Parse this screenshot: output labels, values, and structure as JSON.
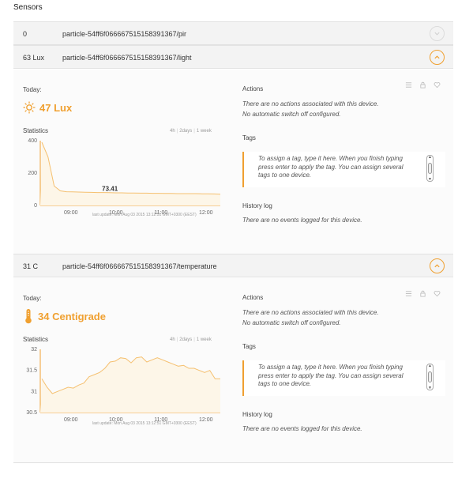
{
  "page_title": "Sensors",
  "colors": {
    "accent": "#f0a030",
    "fill": "#fdf6e8",
    "row_bg": "#f3f3f3"
  },
  "sensors": [
    {
      "value": "0",
      "id": "particle-54ff6f066667515158391367/pir",
      "expanded": false
    },
    {
      "value": "63 Lux",
      "id": "particle-54ff6f066667515158391367/light",
      "expanded": true,
      "icon": "sun-icon",
      "today_label": "Today:",
      "reading": "47 Lux",
      "stats_label": "Statistics",
      "ranges": [
        "4h",
        "2days",
        "1 week"
      ],
      "updated": "last update: Mon Aug 03 2015 13:12:51 GMT+0300 (EEST)",
      "actions_label": "Actions",
      "actions_text": "There are no actions associated with this device.",
      "switch_text": "No automatic switch off configured.",
      "tags_label": "Tags",
      "tags_placeholder": "To assign a tag, type it here. When you finish typing press enter to apply the tag. You can assign several tags to one device.",
      "history_label": "History log",
      "history_text": "There are no events logged for this device."
    },
    {
      "value": "31 C",
      "id": "particle-54ff6f066667515158391367/temperature",
      "expanded": true,
      "icon": "thermometer-icon",
      "today_label": "Today:",
      "reading": "34 Centigrade",
      "stats_label": "Statistics",
      "ranges": [
        "4h",
        "2days",
        "1 week"
      ],
      "updated": "last update: Mon Aug 03 2015 13:12:51 GMT+0300 (EEST)",
      "actions_label": "Actions",
      "actions_text": "There are no actions associated with this device.",
      "switch_text": "No automatic switch off configured.",
      "tags_label": "Tags",
      "tags_placeholder": "To assign a tag, type it here. When you finish typing press enter to apply the tag. You can assign several tags to one device.",
      "history_label": "History log",
      "history_text": "There are no events logged for this device."
    }
  ],
  "chart_data": [
    {
      "type": "area",
      "x_ticks": [
        "09:00",
        "10:00",
        "11:00",
        "12:00"
      ],
      "y_ticks": [
        "400",
        "200",
        "0"
      ],
      "ylim": [
        0,
        400
      ],
      "annotation": "73.41",
      "series": [
        {
          "values": [
            390,
            300,
            120,
            90,
            85,
            84,
            83,
            82,
            81,
            80,
            80,
            79,
            78,
            78,
            77,
            77,
            76,
            76,
            75,
            75,
            74,
            74,
            73,
            73,
            73,
            73,
            72,
            72,
            71,
            70
          ]
        }
      ]
    },
    {
      "type": "area",
      "x_ticks": [
        "09:00",
        "10:00",
        "11:00",
        "12:00"
      ],
      "y_ticks": [
        "32",
        "31.5",
        "31",
        "30.5"
      ],
      "ylim": [
        30.5,
        32
      ],
      "series": [
        {
          "values": [
            31.3,
            31.1,
            30.95,
            31.0,
            31.05,
            31.1,
            31.08,
            31.15,
            31.2,
            31.35,
            31.4,
            31.45,
            31.55,
            31.7,
            31.72,
            31.8,
            31.78,
            31.68,
            31.8,
            31.82,
            31.7,
            31.75,
            31.8,
            31.75,
            31.7,
            31.65,
            31.6,
            31.62,
            31.55,
            31.55,
            31.5,
            31.45,
            31.5,
            31.3,
            31.3
          ]
        }
      ]
    }
  ]
}
